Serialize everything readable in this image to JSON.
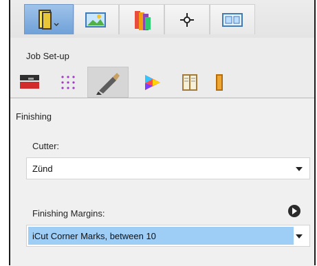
{
  "subheader": {
    "title": "Job Set-up"
  },
  "panel": {
    "section_title": "Finishing",
    "cutter": {
      "label": "Cutter:",
      "value": "Zünd"
    },
    "margins": {
      "label": "Finishing Margins:",
      "value": "iCut Corner Marks, between 10"
    }
  },
  "top_tabs": [
    {
      "name": "job-tab",
      "icon": "booklet-icon",
      "active": true
    },
    {
      "name": "image-tab",
      "icon": "picture-icon"
    },
    {
      "name": "color-tab",
      "icon": "swatches-icon"
    },
    {
      "name": "crosshair-tab",
      "icon": "crosshair-icon"
    },
    {
      "name": "layout-tab",
      "icon": "layout-icon"
    }
  ],
  "icon_tabs": [
    {
      "name": "media-tab",
      "icon": "media-icon"
    },
    {
      "name": "grid-tab",
      "icon": "grid-icon"
    },
    {
      "name": "finishing-tab",
      "icon": "knife-icon",
      "active": true
    },
    {
      "name": "color-tab",
      "icon": "color-wheel-icon"
    },
    {
      "name": "book-tab",
      "icon": "book-icon"
    },
    {
      "name": "more-tab",
      "icon": "partial-icon"
    }
  ]
}
